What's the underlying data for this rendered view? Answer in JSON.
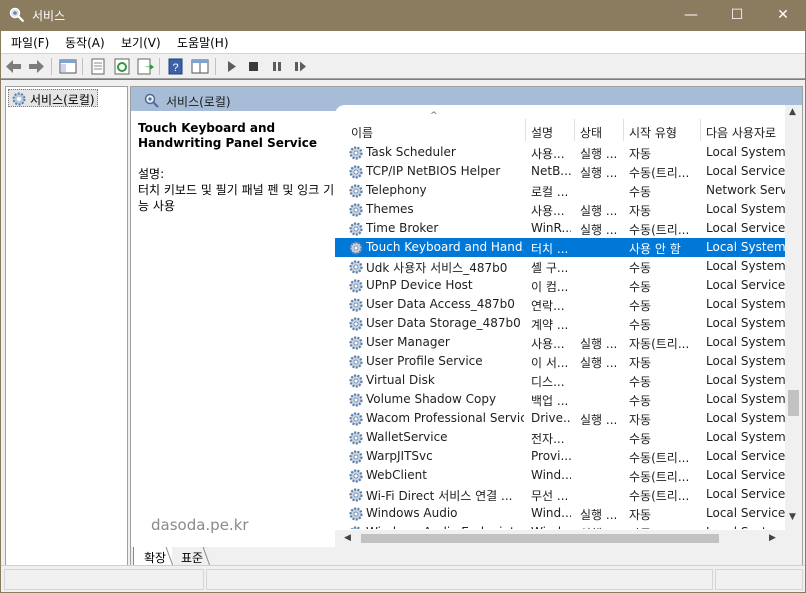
{
  "window": {
    "title": "서비스",
    "icon": "gear-magnifier-icon",
    "controls": {
      "minimize": "—",
      "maximize": "☐",
      "close": "✕"
    }
  },
  "menu": [
    "파일(F)",
    "동작(A)",
    "보기(V)",
    "도움말(H)"
  ],
  "toolbar": {
    "icons": [
      "back-icon",
      "forward-icon",
      "show-tree-icon",
      "properties-icon",
      "refresh-icon",
      "export-icon",
      "help-icon",
      "view-icon",
      "start-icon",
      "stop-icon",
      "pause-icon",
      "restart-icon"
    ]
  },
  "tree": {
    "root_label": "서비스(로컬)"
  },
  "panel": {
    "header_title": "서비스(로컬)",
    "selected_service_name": "Touch Keyboard and Handwriting Panel Service",
    "description_label": "설명:",
    "description_text": "터치 키보드 및 필기 패널 펜 및 잉크 기능 사용",
    "watermark": "dasoda.pe.kr"
  },
  "columns": {
    "name": "이름",
    "description": "설명",
    "status": "상태",
    "startup_type": "시작 유형",
    "logon_as": "다음 사용자로"
  },
  "services": [
    {
      "name": "Task Scheduler",
      "desc": "사용...",
      "status": "실행 ...",
      "startup": "자동",
      "logon": "Local System"
    },
    {
      "name": "TCP/IP NetBIOS Helper",
      "desc": "NetB...",
      "status": "실행 ...",
      "startup": "수동(트리...",
      "logon": "Local Service"
    },
    {
      "name": "Telephony",
      "desc": "로컬 ...",
      "status": "",
      "startup": "수동",
      "logon": "Network Service"
    },
    {
      "name": "Themes",
      "desc": "사용...",
      "status": "실행 ...",
      "startup": "자동",
      "logon": "Local System"
    },
    {
      "name": "Time Broker",
      "desc": "WinR...",
      "status": "실행 ...",
      "startup": "수동(트리...",
      "logon": "Local Service"
    },
    {
      "name": "Touch Keyboard and Hand...",
      "desc": "터치 ...",
      "status": "",
      "startup": "사용 안 함",
      "logon": "Local System",
      "selected": true
    },
    {
      "name": "Udk 사용자 서비스_487b0",
      "desc": "셸 구...",
      "status": "",
      "startup": "수동",
      "logon": "Local System"
    },
    {
      "name": "UPnP Device Host",
      "desc": "이 컴...",
      "status": "",
      "startup": "수동",
      "logon": "Local Service"
    },
    {
      "name": "User Data Access_487b0",
      "desc": "연락...",
      "status": "",
      "startup": "수동",
      "logon": "Local System"
    },
    {
      "name": "User Data Storage_487b0",
      "desc": "계약 ...",
      "status": "",
      "startup": "수동",
      "logon": "Local System"
    },
    {
      "name": "User Manager",
      "desc": "사용...",
      "status": "실행 ...",
      "startup": "자동(트리...",
      "logon": "Local System"
    },
    {
      "name": "User Profile Service",
      "desc": "이 서...",
      "status": "실행 ...",
      "startup": "자동",
      "logon": "Local System"
    },
    {
      "name": "Virtual Disk",
      "desc": "디스...",
      "status": "",
      "startup": "수동",
      "logon": "Local System"
    },
    {
      "name": "Volume Shadow Copy",
      "desc": "백업 ...",
      "status": "",
      "startup": "수동",
      "logon": "Local System"
    },
    {
      "name": "Wacom Professional Service",
      "desc": "Drive...",
      "status": "실행 ...",
      "startup": "자동",
      "logon": "Local System"
    },
    {
      "name": "WalletService",
      "desc": "전자...",
      "status": "",
      "startup": "수동",
      "logon": "Local System"
    },
    {
      "name": "WarpJITSvc",
      "desc": "Provi...",
      "status": "",
      "startup": "수동(트리...",
      "logon": "Local Service"
    },
    {
      "name": "WebClient",
      "desc": "Wind...",
      "status": "",
      "startup": "수동(트리...",
      "logon": "Local Service"
    },
    {
      "name": "Wi-Fi Direct 서비스 연결 ...",
      "desc": "무선 ...",
      "status": "",
      "startup": "수동(트리...",
      "logon": "Local Service"
    },
    {
      "name": "Windows Audio",
      "desc": "Wind...",
      "status": "실행 ...",
      "startup": "자동",
      "logon": "Local Service"
    },
    {
      "name": "Windows Audio Endpoint ...",
      "desc": "Wind...",
      "status": "실행 ...",
      "startup": "자동",
      "logon": "Local System"
    }
  ],
  "tabs": [
    "확장",
    "표준"
  ],
  "colors": {
    "titlebar": "#8b7b5f",
    "selection": "#0078d7",
    "panel_header": "#a7bcd6"
  }
}
